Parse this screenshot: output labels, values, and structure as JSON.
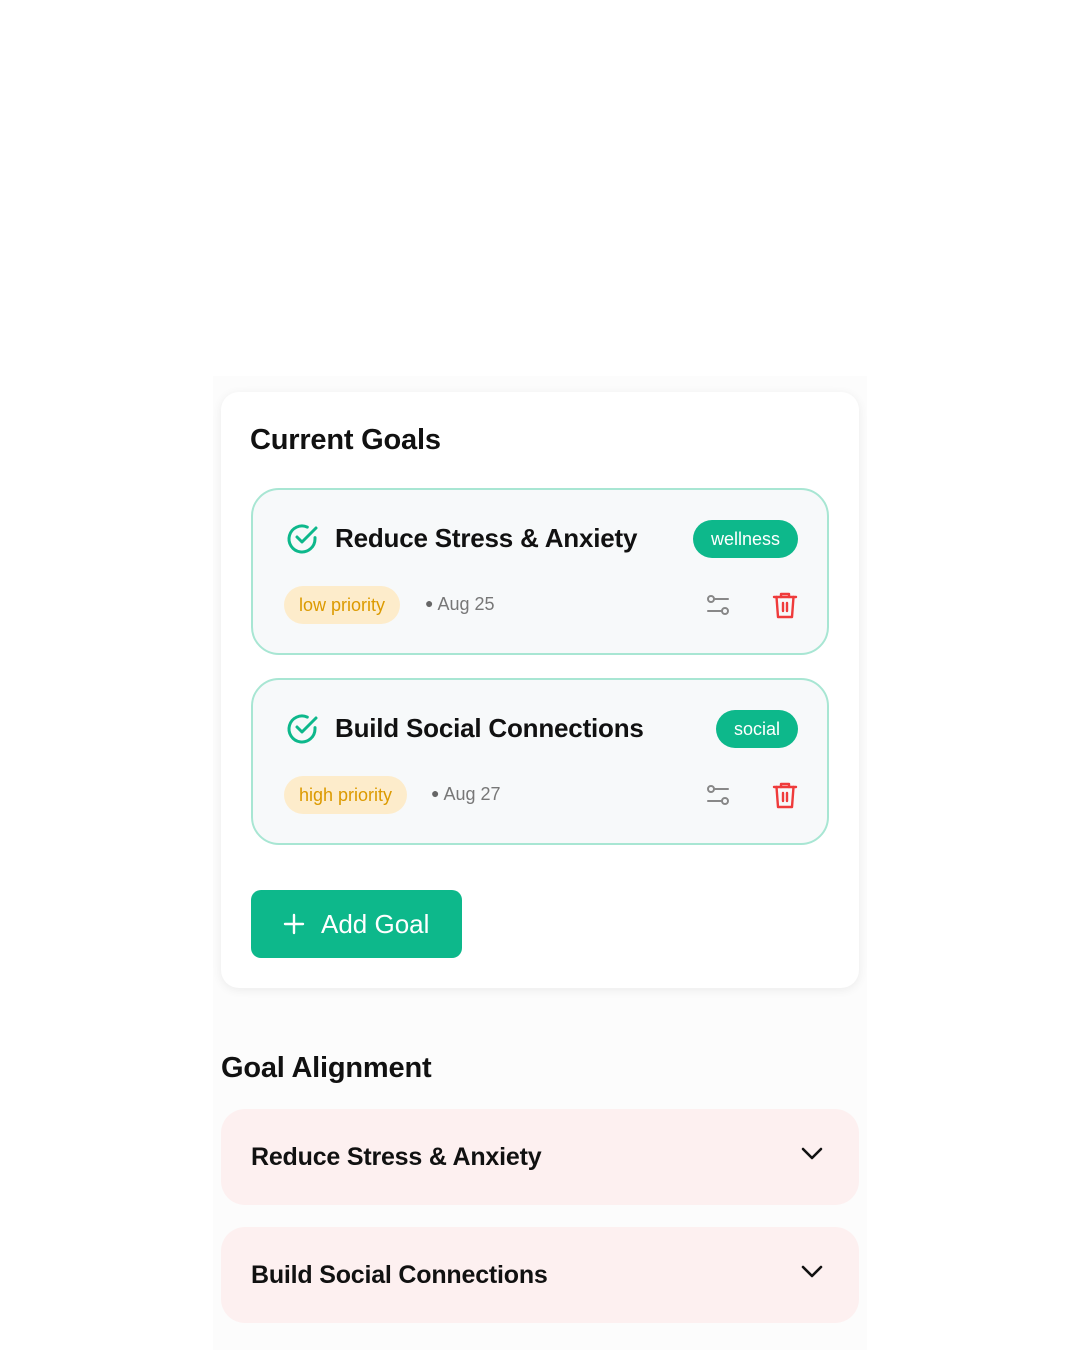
{
  "current_goals": {
    "title": "Current Goals",
    "goals": [
      {
        "title": "Reduce Stress & Anxiety",
        "category": "wellness",
        "priority": "low priority",
        "due": "Aug 25",
        "icons": [
          "check-circle-icon",
          "sliders-icon",
          "trash-icon"
        ]
      },
      {
        "title": "Build Social Connections",
        "category": "social",
        "priority": "high priority",
        "due": "Aug 27",
        "icons": [
          "check-circle-icon",
          "sliders-icon",
          "trash-icon"
        ]
      }
    ],
    "add_button": {
      "label": "Add Goal",
      "icon": "plus-icon"
    }
  },
  "goal_alignment": {
    "title": "Goal Alignment",
    "items": [
      {
        "label": "Reduce Stress & Anxiety",
        "icon": "chevron-down-icon"
      },
      {
        "label": "Build Social Connections",
        "icon": "chevron-down-icon"
      }
    ]
  },
  "colors": {
    "accent": "#0db88b",
    "card_border": "#a8e6d3",
    "priority_bg": "#fdeccb",
    "priority_text": "#dc9a00",
    "delete": "#ef3b3b",
    "accordion_bg": "#fdf0f0"
  }
}
